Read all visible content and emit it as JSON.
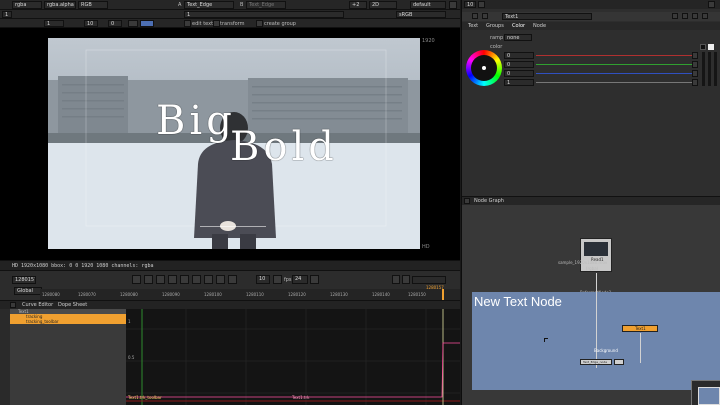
{
  "viewer_toolbar": {
    "channels": "rgba",
    "alpha_channel": "rgba.alpha",
    "display_mode": "RGB",
    "a_label": "A",
    "a_input": "Text_Edge",
    "b_label": "B",
    "b_input": "Text_Edge",
    "gain": "+2",
    "view_mode": "2D",
    "lut": "default",
    "frame": "1",
    "gamma": "1",
    "zoom_value": "10",
    "k_value": "0",
    "viewer_process": "sRGB",
    "edit_text_label": "edit text",
    "transform_label": "transform",
    "create_group_label": "create group",
    "format_tag": "1920",
    "hd_corner_label": "HD",
    "fr_value": "1"
  },
  "viewer": {
    "title_text_line1": "Big",
    "title_text_line2": "Bold",
    "status_text": "HD 1920x1080  bbox: 0 0 1920 1080  channels: rgba"
  },
  "timeline": {
    "current_frame": "1280157",
    "mode": "Global",
    "fps_label": "fps",
    "fps_value": "24",
    "step_value": "10",
    "ticks": [
      "1280080",
      "1280070",
      "1280080",
      "1280090",
      "1280100",
      "1280110",
      "1280120",
      "1280130",
      "1280140",
      "1280150"
    ],
    "end_frame": "1280157"
  },
  "curve_editor": {
    "tabs": [
      "Curve Editor",
      "Dope Sheet"
    ],
    "tree": [
      "Text1",
      "tracking",
      "tracking_toolbar"
    ],
    "y_labels": [
      "1",
      "0.5"
    ],
    "bottom_labels": [
      "Text1.trk_toolbar",
      "Text1.trk"
    ]
  },
  "properties": {
    "toolbar_number": "10",
    "node_name": "Text1",
    "tabs": [
      "Text",
      "Groups",
      "Color",
      "Node"
    ],
    "ramp_label": "ramp",
    "ramp_value": "none",
    "color_label": "color",
    "color_values": [
      "0",
      "0",
      "0",
      "1"
    ]
  },
  "node_graph": {
    "tab_label": "Node Graph",
    "read_node_label": "Read1",
    "read_node_sub": "sample_1920x1080.mov",
    "read_node_extra": "(rgba)",
    "backdrop_title": "New Text Node",
    "node_text1": "Text1",
    "node_background": "Background",
    "node_textedge": "Text_Edge_node",
    "top_node_label": "ReformatNode1"
  },
  "colors": {
    "accent_orange": "#f0a030",
    "backdrop_blue": "#6e86ad",
    "selection_blue": "#4d6fb3"
  }
}
